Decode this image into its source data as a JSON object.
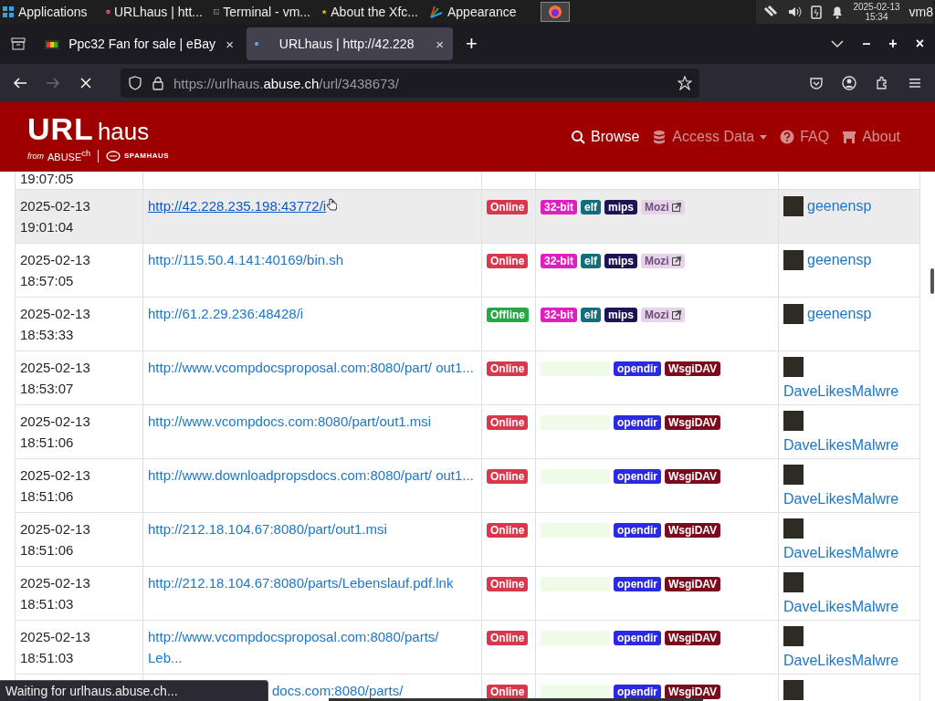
{
  "taskbar": {
    "items": [
      {
        "label": "Applications",
        "selected": false
      },
      {
        "label": "URLhaus | htt...",
        "selected": false
      },
      {
        "label": "Terminal - vm...",
        "selected": false
      },
      {
        "label": "About the Xfc...",
        "selected": false
      },
      {
        "label": "Appearance",
        "selected": false
      }
    ],
    "date": "2025-02-13",
    "time": "15:34",
    "user": "vm8"
  },
  "browser": {
    "tabs": [
      {
        "title": "Ppc32 Fan for sale | eBay",
        "close": "×",
        "selected": false
      },
      {
        "title": "URLhaus | http://42.228",
        "close": "×",
        "selected": true
      }
    ],
    "new_tab": "+",
    "window_buttons": [
      "–",
      "+",
      "×"
    ],
    "url_parts": [
      {
        "text": "https://urlhaus.",
        "emphasized": false
      },
      {
        "text": "abuse.ch",
        "emphasized": true
      },
      {
        "text": "/url/3438673/",
        "emphasized": false
      }
    ]
  },
  "site": {
    "logo": {
      "main": "URL",
      "rest": "haus",
      "from": "from",
      "abuse": "ABUSE",
      "ch": "ch",
      "partner": "SPAMHAUS"
    },
    "nav": [
      {
        "label": "Browse",
        "selected": true,
        "dropdown": false
      },
      {
        "label": "Access Data",
        "selected": false,
        "dropdown": true
      },
      {
        "label": "FAQ",
        "selected": false,
        "dropdown": false
      },
      {
        "label": "About",
        "selected": false,
        "dropdown": false
      }
    ]
  },
  "table": {
    "partial_time": "19:07:05",
    "rows": [
      {
        "date": "2025-02-13",
        "time": "19:01:04",
        "url": "http://42.228.235.198:43772/i",
        "hovered": true,
        "status": {
          "label": "Online",
          "color": "#d9374b"
        },
        "tags": [
          {
            "label": "32-bit",
            "kind": "tag",
            "color": "#e01fc0"
          },
          {
            "label": "elf",
            "kind": "tag",
            "color": "#146c7c"
          },
          {
            "label": "mips",
            "kind": "tag",
            "color": "#1d1456"
          },
          {
            "label": "Mozi",
            "kind": "link",
            "color": "#e6d3ea"
          }
        ],
        "reporter": "geenensp"
      },
      {
        "date": "2025-02-13",
        "time": "18:57:05",
        "url": "http://115.50.4.141:40169/bin.sh",
        "hovered": false,
        "status": {
          "label": "Online",
          "color": "#d9374b"
        },
        "tags": [
          {
            "label": "32-bit",
            "kind": "tag",
            "color": "#e01fc0"
          },
          {
            "label": "elf",
            "kind": "tag",
            "color": "#146c7c"
          },
          {
            "label": "mips",
            "kind": "tag",
            "color": "#1d1456"
          },
          {
            "label": "Mozi",
            "kind": "link",
            "color": "#e6d3ea"
          }
        ],
        "reporter": "geenensp"
      },
      {
        "date": "2025-02-13",
        "time": "18:53:33",
        "url": "http://61.2.29.236:48428/i",
        "hovered": false,
        "status": {
          "label": "Offline",
          "color": "#26a745"
        },
        "tags": [
          {
            "label": "32-bit",
            "kind": "tag",
            "color": "#e01fc0"
          },
          {
            "label": "elf",
            "kind": "tag",
            "color": "#146c7c"
          },
          {
            "label": "mips",
            "kind": "tag",
            "color": "#1d1456"
          },
          {
            "label": "Mozi",
            "kind": "link",
            "color": "#e6d3ea"
          }
        ],
        "reporter": "geenensp"
      },
      {
        "date": "2025-02-13",
        "time": "18:53:07",
        "url": "http://www.vcompdocsproposal.com:8080/part/ out1...",
        "hovered": false,
        "status": {
          "label": "Online",
          "color": "#d9374b"
        },
        "tags": [
          {
            "kind": "blank",
            "color": "#eefbe8"
          },
          {
            "label": "opendir",
            "kind": "tag",
            "color": "#2b2ae0"
          },
          {
            "label": "WsgiDAV",
            "kind": "tag",
            "color": "#7b0a1c"
          }
        ],
        "reporter": "DaveLikesMalwre"
      },
      {
        "date": "2025-02-13",
        "time": "18:51:06",
        "url": "http://www.vcompdocs.com:8080/part/out1.msi",
        "hovered": false,
        "status": {
          "label": "Online",
          "color": "#d9374b"
        },
        "tags": [
          {
            "kind": "blank",
            "color": "#eefbe8"
          },
          {
            "label": "opendir",
            "kind": "tag",
            "color": "#2b2ae0"
          },
          {
            "label": "WsgiDAV",
            "kind": "tag",
            "color": "#7b0a1c"
          }
        ],
        "reporter": "DaveLikesMalwre"
      },
      {
        "date": "2025-02-13",
        "time": "18:51:06",
        "url": "http://www.downloadpropsdocs.com:8080/part/ out1...",
        "hovered": false,
        "status": {
          "label": "Online",
          "color": "#d9374b"
        },
        "tags": [
          {
            "kind": "blank",
            "color": "#eefbe8"
          },
          {
            "label": "opendir",
            "kind": "tag",
            "color": "#2b2ae0"
          },
          {
            "label": "WsgiDAV",
            "kind": "tag",
            "color": "#7b0a1c"
          }
        ],
        "reporter": "DaveLikesMalwre"
      },
      {
        "date": "2025-02-13",
        "time": "18:51:06",
        "url": "http://212.18.104.67:8080/part/out1.msi",
        "hovered": false,
        "status": {
          "label": "Online",
          "color": "#d9374b"
        },
        "tags": [
          {
            "kind": "blank",
            "color": "#eefbe8"
          },
          {
            "label": "opendir",
            "kind": "tag",
            "color": "#2b2ae0"
          },
          {
            "label": "WsgiDAV",
            "kind": "tag",
            "color": "#7b0a1c"
          }
        ],
        "reporter": "DaveLikesMalwre"
      },
      {
        "date": "2025-02-13",
        "time": "18:51:03",
        "url": "http://212.18.104.67:8080/parts/Lebenslauf.pdf.lnk",
        "hovered": false,
        "status": {
          "label": "Online",
          "color": "#d9374b"
        },
        "tags": [
          {
            "kind": "blank",
            "color": "#eefbe8"
          },
          {
            "label": "opendir",
            "kind": "tag",
            "color": "#2b2ae0"
          },
          {
            "label": "WsgiDAV",
            "kind": "tag",
            "color": "#7b0a1c"
          }
        ],
        "reporter": "DaveLikesMalwre"
      },
      {
        "date": "2025-02-13",
        "time": "18:51:03",
        "url": "http://www.vcompdocsproposal.com:8080/parts/ Leb...",
        "hovered": false,
        "status": {
          "label": "Online",
          "color": "#d9374b"
        },
        "tags": [
          {
            "kind": "blank",
            "color": "#eefbe8"
          },
          {
            "label": "opendir",
            "kind": "tag",
            "color": "#2b2ae0"
          },
          {
            "label": "WsgiDAV",
            "kind": "tag",
            "color": "#7b0a1c"
          }
        ],
        "reporter": "DaveLikesMalwre"
      },
      {
        "url": "docs.com:8080/parts/",
        "hovered": false,
        "status": {
          "label": "Online",
          "color": "#d9374b"
        },
        "tags": [
          {
            "kind": "blank",
            "color": "#eefbe8"
          },
          {
            "label": "opendir",
            "kind": "tag",
            "color": "#2b2ae0"
          },
          {
            "label": "WsgiDAV",
            "kind": "tag",
            "color": "#7b0a1c"
          }
        ]
      }
    ]
  },
  "status_bar": "Waiting for urlhaus.abuse.ch..."
}
